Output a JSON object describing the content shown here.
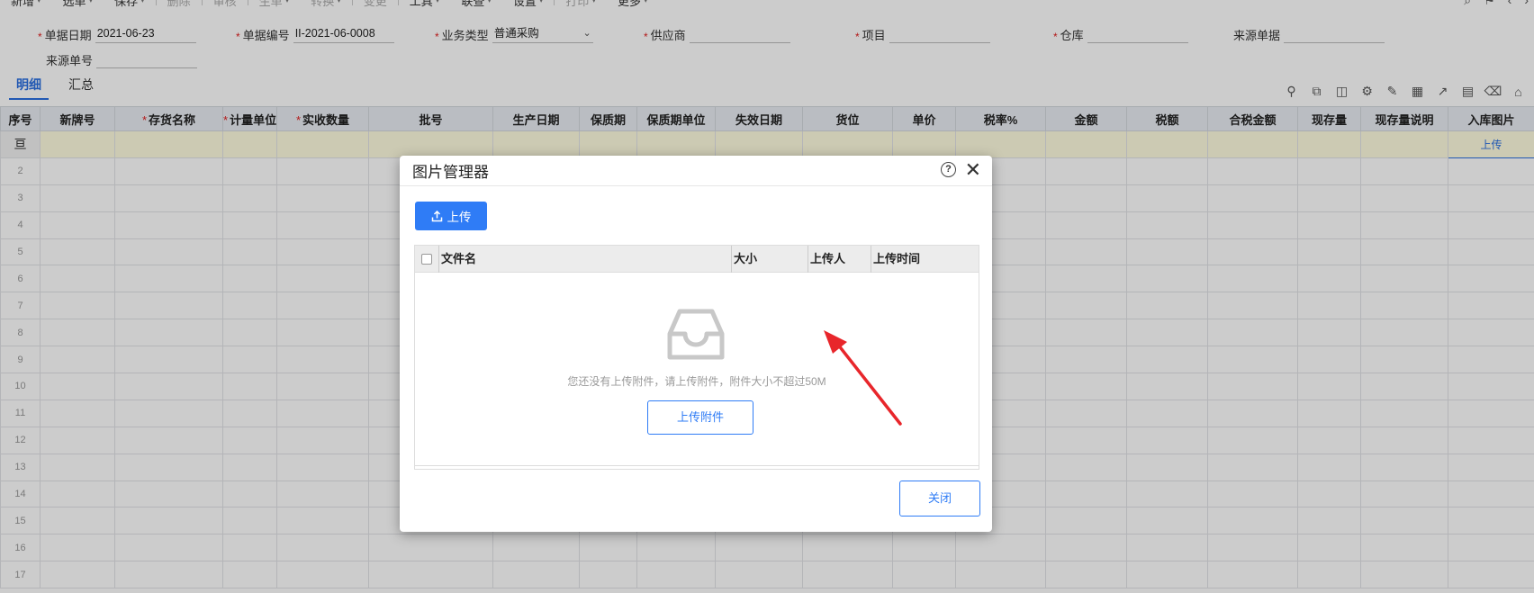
{
  "toolbar": {
    "items": [
      {
        "label": "新增",
        "disabled": false,
        "caret": true
      },
      {
        "label": "选单",
        "disabled": false,
        "caret": true
      },
      {
        "label": "保存",
        "disabled": false,
        "caret": true
      },
      {
        "label": "删除",
        "disabled": true,
        "caret": false
      },
      {
        "label": "审核",
        "disabled": true,
        "caret": false
      },
      {
        "label": "生单",
        "disabled": true,
        "caret": true
      },
      {
        "label": "转换",
        "disabled": true,
        "caret": true
      },
      {
        "label": "变更",
        "disabled": true,
        "caret": false
      },
      {
        "label": "工具",
        "disabled": false,
        "caret": true
      },
      {
        "label": "联查",
        "disabled": false,
        "caret": true
      },
      {
        "label": "设置",
        "disabled": false,
        "caret": true
      },
      {
        "label": "打印",
        "disabled": true,
        "caret": true
      },
      {
        "label": "更多",
        "disabled": false,
        "caret": true
      }
    ]
  },
  "form": {
    "doc_date": {
      "label": "单据日期",
      "value": "2021-06-23"
    },
    "doc_no": {
      "label": "单据编号",
      "value": "II-2021-06-0008"
    },
    "biz_type": {
      "label": "业务类型",
      "value": "普通采购"
    },
    "supplier": {
      "label": "供应商",
      "value": ""
    },
    "project": {
      "label": "项目",
      "value": ""
    },
    "warehouse": {
      "label": "仓库",
      "value": ""
    },
    "source_doc": {
      "label": "来源单据",
      "value": ""
    },
    "source_no": {
      "label": "来源单号",
      "value": ""
    }
  },
  "tabs": [
    {
      "label": "明细",
      "active": true
    },
    {
      "label": "汇总",
      "active": false
    }
  ],
  "grid": {
    "columns": [
      {
        "label": "序号",
        "required": false
      },
      {
        "label": "新牌号",
        "required": false
      },
      {
        "label": "存货名称",
        "required": true
      },
      {
        "label": "计量单位",
        "required": true
      },
      {
        "label": "实收数量",
        "required": true
      },
      {
        "label": "批号",
        "required": false
      },
      {
        "label": "生产日期",
        "required": false
      },
      {
        "label": "保质期",
        "required": false
      },
      {
        "label": "保质期单位",
        "required": false
      },
      {
        "label": "失效日期",
        "required": false
      },
      {
        "label": "货位",
        "required": false
      },
      {
        "label": "单价",
        "required": false
      },
      {
        "label": "税率%",
        "required": false
      },
      {
        "label": "金额",
        "required": false
      },
      {
        "label": "税额",
        "required": false
      },
      {
        "label": "合税金额",
        "required": false
      },
      {
        "label": "现存量",
        "required": false
      },
      {
        "label": "现存量说明",
        "required": false
      },
      {
        "label": "入库图片",
        "required": false
      }
    ],
    "row_numbers": [
      "",
      "2",
      "3",
      "4",
      "5",
      "6",
      "7",
      "8",
      "9",
      "10",
      "11",
      "12",
      "13",
      "14",
      "15",
      "16",
      "17"
    ],
    "first_row_marker": "亘",
    "upload_link": "上传"
  },
  "dialog": {
    "title": "图片管理器",
    "help_icon": "?",
    "upload_button": "上传",
    "table_headers": {
      "filename": "文件名",
      "size": "大小",
      "uploader": "上传人",
      "upload_time": "上传时间"
    },
    "empty_text": "您还没有上传附件，请上传附件，附件大小不超过50M",
    "upload_attachment_button": "上传附件",
    "close_button": "关闭"
  },
  "colors": {
    "primary": "#2f7cf6",
    "required": "#e02020",
    "annotation_arrow": "#e8262b"
  }
}
